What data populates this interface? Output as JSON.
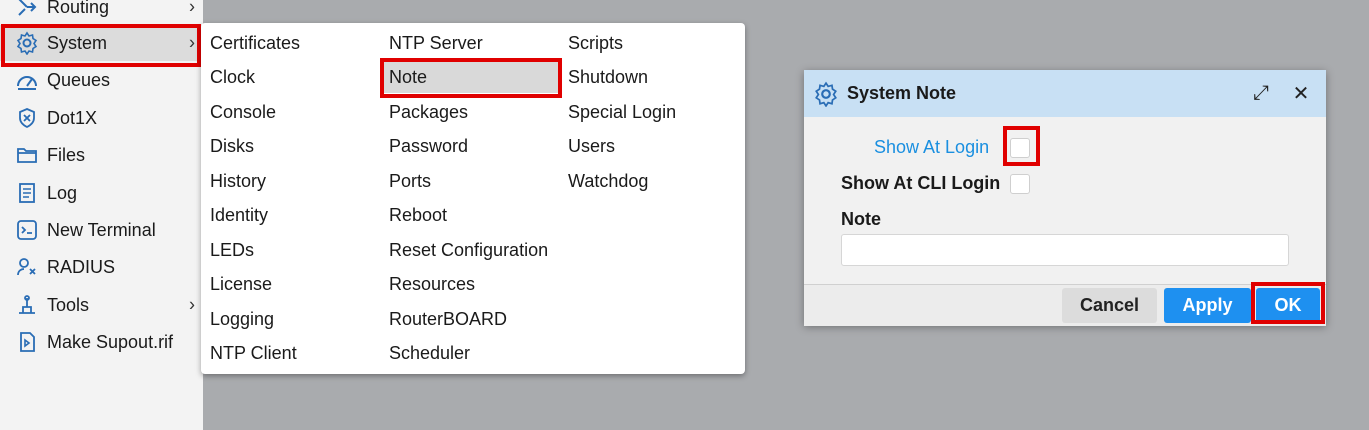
{
  "sidebar": {
    "items": [
      {
        "label": "Routing",
        "icon": "routing-icon",
        "has_submenu": true
      },
      {
        "label": "System",
        "icon": "gear-icon",
        "has_submenu": true
      },
      {
        "label": "Queues",
        "icon": "queues-icon",
        "has_submenu": false
      },
      {
        "label": "Dot1X",
        "icon": "dot1x-icon",
        "has_submenu": false
      },
      {
        "label": "Files",
        "icon": "folder-icon",
        "has_submenu": false
      },
      {
        "label": "Log",
        "icon": "log-icon",
        "has_submenu": false
      },
      {
        "label": "New Terminal",
        "icon": "terminal-icon",
        "has_submenu": false
      },
      {
        "label": "RADIUS",
        "icon": "radius-icon",
        "has_submenu": false
      },
      {
        "label": "Tools",
        "icon": "tools-icon",
        "has_submenu": true
      },
      {
        "label": "Make Supout.rif",
        "icon": "supout-icon",
        "has_submenu": false
      }
    ],
    "chevron": "›"
  },
  "system_menu": {
    "col1": [
      "Certificates",
      "Clock",
      "Console",
      "Disks",
      "History",
      "Identity",
      "LEDs",
      "License",
      "Logging",
      "NTP Client"
    ],
    "col2": [
      "NTP Server",
      "Note",
      "Packages",
      "Password",
      "Ports",
      "Reboot",
      "Reset Configuration",
      "Resources",
      "RouterBOARD",
      "Scheduler"
    ],
    "col3": [
      "Scripts",
      "Shutdown",
      "Special Login",
      "Users",
      "Watchdog"
    ],
    "selected": "Note"
  },
  "dialog": {
    "title": "System Note",
    "show_at_login_label": "Show At Login",
    "show_at_cli_login_label": "Show At CLI Login",
    "note_label": "Note",
    "note_value": "",
    "cancel_label": "Cancel",
    "apply_label": "Apply",
    "ok_label": "OK",
    "maximize_glyph": "⤢",
    "close_glyph": "✕"
  },
  "colors": {
    "accent": "#1e90f0",
    "highlight_box": "#e00000",
    "dialog_header": "#c8e0f4",
    "link_blue": "#1a8fe0"
  }
}
